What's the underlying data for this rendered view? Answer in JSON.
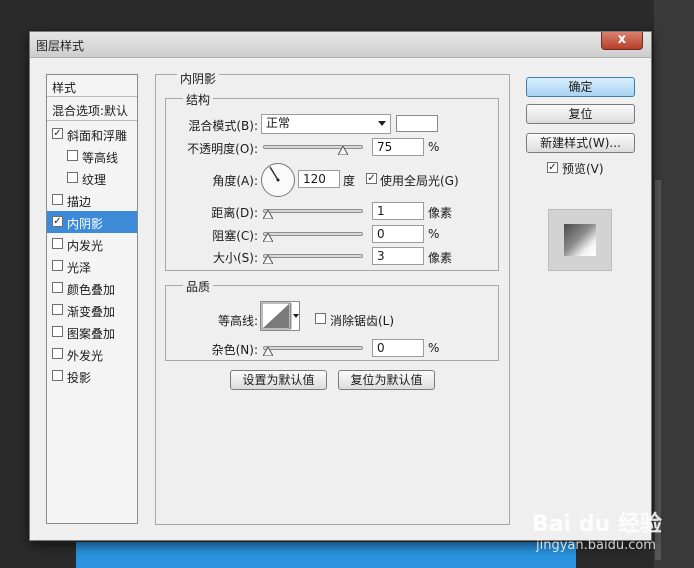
{
  "window": {
    "title": "图层样式",
    "close_symbol": "x"
  },
  "style_list": {
    "header": "样式",
    "blend_options": "混合选项:默认",
    "items": [
      {
        "label": "斜面和浮雕",
        "checked": true
      },
      {
        "label": "等高线",
        "checked": false
      },
      {
        "label": "纹理",
        "checked": false
      },
      {
        "label": "描边",
        "checked": false
      },
      {
        "label": "内阴影",
        "checked": true,
        "selected": true
      },
      {
        "label": "内发光",
        "checked": false
      },
      {
        "label": "光泽",
        "checked": false
      },
      {
        "label": "颜色叠加",
        "checked": false
      },
      {
        "label": "渐变叠加",
        "checked": false
      },
      {
        "label": "图案叠加",
        "checked": false
      },
      {
        "label": "外发光",
        "checked": false
      },
      {
        "label": "投影",
        "checked": false
      }
    ]
  },
  "panel": {
    "title": "内阴影",
    "structure": {
      "title": "结构",
      "blend_mode_label": "混合模式(B):",
      "blend_mode_value": "正常",
      "opacity_label": "不透明度(O):",
      "opacity_value": "75",
      "opacity_unit": "%",
      "angle_label": "角度(A):",
      "angle_value": "120",
      "angle_unit": "度",
      "global_light_label": "使用全局光(G)",
      "global_light_checked": true,
      "distance_label": "距离(D):",
      "distance_value": "1",
      "distance_unit": "像素",
      "choke_label": "阻塞(C):",
      "choke_value": "0",
      "choke_unit": "%",
      "size_label": "大小(S):",
      "size_value": "3",
      "size_unit": "像素"
    },
    "quality": {
      "title": "品质",
      "contour_label": "等高线:",
      "antialias_label": "消除锯齿(L)",
      "antialias_checked": false,
      "noise_label": "杂色(N):",
      "noise_value": "0",
      "noise_unit": "%"
    },
    "make_default_button": "设置为默认值",
    "reset_default_button": "复位为默认值"
  },
  "buttons": {
    "ok": "确定",
    "reset": "复位",
    "new_style": "新建样式(W)...",
    "preview_label": "预览(V)",
    "preview_checked": true
  },
  "sliders": {
    "opacity_fraction": 0.75,
    "distance_fraction": 0.0,
    "choke_fraction": 0.0,
    "size_fraction": 0.0,
    "noise_fraction": 0.0
  },
  "watermark": {
    "brand": "Bai du 经验",
    "url": "jingyan.baidu.com"
  },
  "colors": {
    "selected_item": "#3d8bd8",
    "primary_button": "#a8d4f3",
    "close_button": "#b53f2b"
  }
}
